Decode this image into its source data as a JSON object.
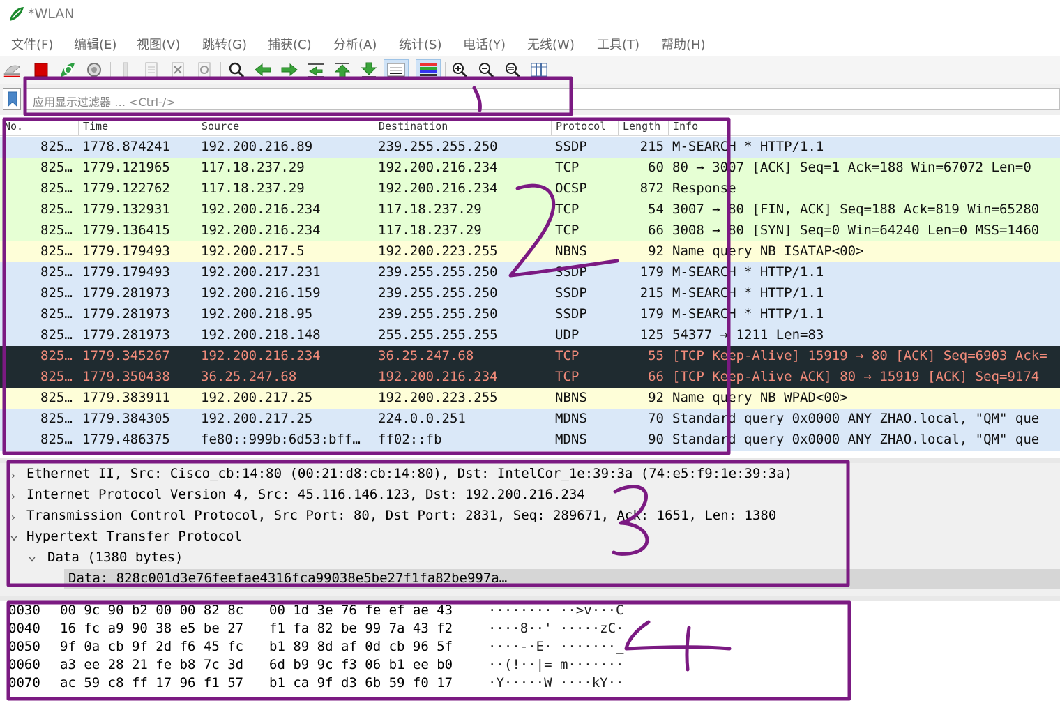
{
  "window": {
    "title": "*WLAN"
  },
  "menu": [
    "文件(F)",
    "编辑(E)",
    "视图(V)",
    "跳转(G)",
    "捕获(C)",
    "分析(A)",
    "统计(S)",
    "电话(Y)",
    "无线(W)",
    "工具(T)",
    "帮助(H)"
  ],
  "toolbar": {
    "icons": [
      "shark-fin-start-icon",
      "stop-capture-icon",
      "restart-capture-icon",
      "capture-options-icon",
      "open-file-icon",
      "save-file-icon",
      "close-file-icon",
      "reload-file-icon",
      "find-packet-icon",
      "go-back-icon",
      "go-forward-icon",
      "go-to-packet-icon",
      "first-packet-icon",
      "last-packet-icon",
      "autoscroll-icon",
      "colorize-icon",
      "zoom-in-icon",
      "zoom-out-icon",
      "normal-size-icon",
      "resize-columns-icon"
    ]
  },
  "filter": {
    "placeholder": "应用显示过滤器 … <Ctrl-/>"
  },
  "packet_list": {
    "columns": [
      "No.",
      "Time",
      "Source",
      "Destination",
      "Protocol",
      "Length",
      "Info"
    ],
    "rows": [
      {
        "no": "825…",
        "time": "1778.874241",
        "src": "192.200.216.89",
        "dst": "239.255.255.250",
        "proto": "SSDP",
        "len": "215",
        "info": "M-SEARCH * HTTP/1.1",
        "bg": "#dae8f8",
        "fg": "#111111"
      },
      {
        "no": "825…",
        "time": "1779.121965",
        "src": "117.18.237.29",
        "dst": "192.200.216.234",
        "proto": "TCP",
        "len": "60",
        "info": "80 → 3007 [ACK] Seq=1 Ack=188 Win=67072 Len=0",
        "bg": "#e6ffd4",
        "fg": "#111111"
      },
      {
        "no": "825…",
        "time": "1779.122762",
        "src": "117.18.237.29",
        "dst": "192.200.216.234",
        "proto": "OCSP",
        "len": "872",
        "info": "Response",
        "bg": "#e6ffd4",
        "fg": "#111111"
      },
      {
        "no": "825…",
        "time": "1779.132931",
        "src": "192.200.216.234",
        "dst": "117.18.237.29",
        "proto": "TCP",
        "len": "54",
        "info": "3007 → 80 [FIN, ACK] Seq=188 Ack=819 Win=65280",
        "bg": "#e6ffd4",
        "fg": "#111111"
      },
      {
        "no": "825…",
        "time": "1779.136415",
        "src": "192.200.216.234",
        "dst": "117.18.237.29",
        "proto": "TCP",
        "len": "66",
        "info": "3008 → 80 [SYN] Seq=0 Win=64240 Len=0 MSS=1460",
        "bg": "#e6ffd4",
        "fg": "#111111"
      },
      {
        "no": "825…",
        "time": "1779.179493",
        "src": "192.200.217.5",
        "dst": "192.200.223.255",
        "proto": "NBNS",
        "len": "92",
        "info": "Name query NB ISATAP<00>",
        "bg": "#fefed8",
        "fg": "#111111"
      },
      {
        "no": "825…",
        "time": "1779.179493",
        "src": "192.200.217.231",
        "dst": "239.255.255.250",
        "proto": "SSDP",
        "len": "179",
        "info": "M-SEARCH * HTTP/1.1",
        "bg": "#dae8f8",
        "fg": "#111111"
      },
      {
        "no": "825…",
        "time": "1779.281973",
        "src": "192.200.216.159",
        "dst": "239.255.255.250",
        "proto": "SSDP",
        "len": "215",
        "info": "M-SEARCH * HTTP/1.1",
        "bg": "#dae8f8",
        "fg": "#111111"
      },
      {
        "no": "825…",
        "time": "1779.281973",
        "src": "192.200.218.95",
        "dst": "239.255.255.250",
        "proto": "SSDP",
        "len": "179",
        "info": "M-SEARCH * HTTP/1.1",
        "bg": "#dae8f8",
        "fg": "#111111"
      },
      {
        "no": "825…",
        "time": "1779.281973",
        "src": "192.200.218.148",
        "dst": "255.255.255.255",
        "proto": "UDP",
        "len": "125",
        "info": "54377 → 1211 Len=83",
        "bg": "#dae8f8",
        "fg": "#111111"
      },
      {
        "no": "825…",
        "time": "1779.345267",
        "src": "192.200.216.234",
        "dst": "36.25.247.68",
        "proto": "TCP",
        "len": "55",
        "info": "[TCP Keep-Alive] 15919 → 80 [ACK] Seq=6903 Ack=",
        "bg": "#1f2b30",
        "fg": "#f28b7a"
      },
      {
        "no": "825…",
        "time": "1779.350438",
        "src": "36.25.247.68",
        "dst": "192.200.216.234",
        "proto": "TCP",
        "len": "66",
        "info": "[TCP Keep-Alive ACK] 80 → 15919 [ACK] Seq=9174",
        "bg": "#1f2b30",
        "fg": "#f28b7a"
      },
      {
        "no": "825…",
        "time": "1779.383911",
        "src": "192.200.217.25",
        "dst": "192.200.223.255",
        "proto": "NBNS",
        "len": "92",
        "info": "Name query NB WPAD<00>",
        "bg": "#fefed8",
        "fg": "#111111"
      },
      {
        "no": "825…",
        "time": "1779.384305",
        "src": "192.200.217.25",
        "dst": "224.0.0.251",
        "proto": "MDNS",
        "len": "70",
        "info": "Standard query 0x0000 ANY ZHAO.local, \"QM\" que",
        "bg": "#dae8f8",
        "fg": "#111111"
      },
      {
        "no": "825…",
        "time": "1779.486375",
        "src": "fe80::999b:6d53:bff…",
        "dst": "ff02::fb",
        "proto": "MDNS",
        "len": "90",
        "info": "Standard query 0x0000 ANY ZHAO.local, \"QM\" que",
        "bg": "#dae8f8",
        "fg": "#111111"
      }
    ]
  },
  "details": {
    "rows": [
      {
        "indent": 0,
        "expanded": false,
        "text": "Ethernet II, Src: Cisco_cb:14:80 (00:21:d8:cb:14:80), Dst: IntelCor_1e:39:3a (74:e5:f9:1e:39:3a)"
      },
      {
        "indent": 0,
        "expanded": false,
        "text": "Internet Protocol Version 4, Src: 45.116.146.123, Dst: 192.200.216.234"
      },
      {
        "indent": 0,
        "expanded": false,
        "text": "Transmission Control Protocol, Src Port: 80, Dst Port: 2831, Seq: 289671, Ack: 1651, Len: 1380"
      },
      {
        "indent": 0,
        "expanded": true,
        "text": "Hypertext Transfer Protocol"
      },
      {
        "indent": 1,
        "expanded": true,
        "text": "Data (1380 bytes)"
      },
      {
        "indent": 2,
        "expanded": null,
        "text": "Data: 828c001d3e76feefae4316fca99038e5be27f1fa82be997a…",
        "selected": true
      }
    ]
  },
  "hex": {
    "rows": [
      {
        "offset": "0030",
        "bytes1": "00 9c 90 b2 00 00 82 8c",
        "bytes2": "00 1d 3e 76 fe ef ae 43",
        "ascii": "········ ··>v···C"
      },
      {
        "offset": "0040",
        "bytes1": "16 fc a9 90 38 e5 be 27",
        "bytes2": "f1 fa 82 be 99 7a 43 f2",
        "ascii": "····8··' ·····zC·"
      },
      {
        "offset": "0050",
        "bytes1": "9f 0a cb 9f 2d f6 45 fc",
        "bytes2": "b1 89 8d af 0d cb 96 5f",
        "ascii": "····-·E· ·······_"
      },
      {
        "offset": "0060",
        "bytes1": "a3 ee 28 21 fe b8 7c 3d",
        "bytes2": "6d b9 9c f3 06 b1 ee b0",
        "ascii": "··(!··|= m·······"
      },
      {
        "offset": "0070",
        "bytes1": "ac 59 c8 ff 17 96 f1 57",
        "bytes2": "b1 ca 9f d3 6b 59 f0 17",
        "ascii": "·Y·····W ····kY··"
      }
    ]
  },
  "annotations": {
    "labels": [
      "1",
      "2",
      "3",
      "4"
    ],
    "color": "#7b1a82"
  }
}
